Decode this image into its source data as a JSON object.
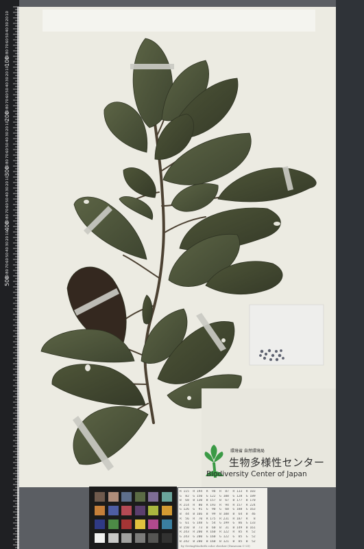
{
  "specimen": {
    "institution_jp_small": "環境省 自然環境局",
    "institution_jp_large": "生物多様性センター",
    "institution_en": "Biodiversity Center of Japan",
    "logo": "plant-sprout-logo",
    "seed_packet_label": "",
    "ruler_labels": [
      "10",
      "20",
      "30",
      "40",
      "50",
      "60",
      "70",
      "80",
      "90",
      "100",
      "10",
      "20",
      "30",
      "40",
      "50",
      "60",
      "70",
      "80",
      "90",
      "200",
      "10",
      "20",
      "30",
      "40",
      "50",
      "60",
      "70",
      "80",
      "90",
      "300",
      "10",
      "20",
      "30",
      "40",
      "50",
      "60",
      "70",
      "80",
      "90",
      "400",
      "10",
      "20",
      "30",
      "40",
      "50",
      "60",
      "70",
      "80",
      "90",
      "500"
    ]
  },
  "color_chart": {
    "patches": [
      "#6f5a4d",
      "#b08e7b",
      "#5e6f8b",
      "#5b6b45",
      "#7e6d95",
      "#6aa59c",
      "#c6803a",
      "#4e5da3",
      "#b44a55",
      "#5b3f6d",
      "#a8b73f",
      "#d39a32",
      "#2f3a85",
      "#4d8a46",
      "#a53535",
      "#e1c23e",
      "#b24a8e",
      "#3a7fa0",
      "#f2f2f0",
      "#c8c8c6",
      "#a2a2a0",
      "#7c7c7a",
      "#555553",
      "#323231"
    ]
  },
  "reference_card": {
    "rows": [
      "R 115  R 194  R  98  R  87  R 133  R 103",
      "G  82  G 150  G 122  G 108  G 128  G 189",
      "B  68  B 130  B 157  B  67  B 177  B 170",
      "R 214  R  80  R 193  R  94  R 157  R 224",
      "G 126  G  91  G  90  G  60  G 188  G 163",
      "B  44  B 166  B  99  B 108  B  64  B  46",
      "R  56  R  70  R 175  R 231  R 187  R   8",
      "G  61  G 148  G  54  G 199  G  86  G 133",
      "B 150  B  73  B  60  B  31  B 149  B 161",
      "R 243  R 200  R 160  R 122  R  85  R  52",
      "G 243  G 200  G 160  G 122  G  85  G  52",
      "B 242  B 200  B 160  B 121  B  85  B  52"
    ],
    "footer": "by GretagMacbeth color checker (Danzcam C-25)"
  }
}
